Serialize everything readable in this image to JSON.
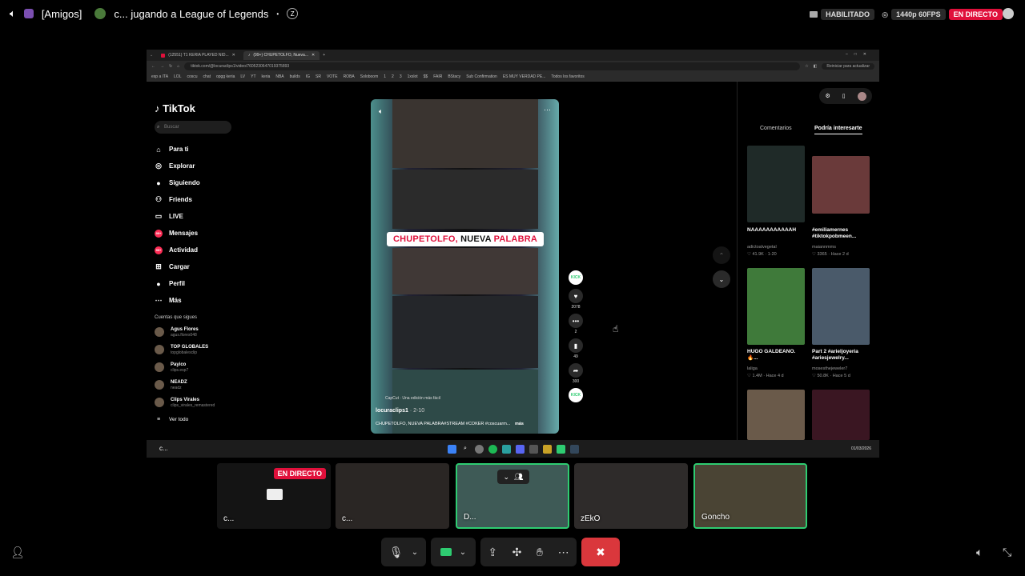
{
  "topbar": {
    "server": "[Amigos]",
    "activity": "c... jugando a League of Legends",
    "status_label": "HABILITADO",
    "quality": "1440p 60FPS",
    "live": "EN DIRECTO"
  },
  "browser": {
    "tabs": [
      {
        "label": "(12551) T1 KERIA PLAYED NID..."
      },
      {
        "label": "(99+) CHUPETOLFO, Nueva..."
      }
    ],
    "url": "tiktok.com/@locuraclips1/video/7605230647019375893",
    "update_button": "Reiniciar para actualizar",
    "bookmarks": [
      "esp a ITA",
      "LOL",
      "coscu",
      "chat",
      "opgg keria",
      "LV",
      "YT",
      "keria",
      "NBA",
      "builds",
      "IG",
      "SR",
      "VOTE",
      "ROBA",
      "Soloboom",
      "1",
      "2",
      "3",
      "1xslot",
      "$$",
      "FAIR",
      "BStacy",
      "Sub Confirmation",
      "ES MUY VERDAD PE...",
      "Todos los favoritos"
    ]
  },
  "tiktok": {
    "logo": "TikTok",
    "search_placeholder": "Buscar",
    "nav": [
      {
        "label": "Para ti",
        "icon": "home-icon"
      },
      {
        "label": "Explorar",
        "icon": "compass-icon"
      },
      {
        "label": "Siguiendo",
        "icon": "following-icon"
      },
      {
        "label": "Friends",
        "icon": "friends-icon"
      },
      {
        "label": "LIVE",
        "icon": "live-icon"
      },
      {
        "label": "Mensajes",
        "icon": "messages-icon"
      },
      {
        "label": "Actividad",
        "icon": "activity-icon"
      },
      {
        "label": "Cargar",
        "icon": "upload-icon"
      },
      {
        "label": "Perfil",
        "icon": "profile-icon"
      },
      {
        "label": "Más",
        "icon": "more-icon"
      }
    ],
    "badge": "99+",
    "following_title": "Cuentas que sigues",
    "accounts": [
      {
        "name": "Agus Flores",
        "handle": "agus.flores048"
      },
      {
        "name": "TOP GLOBALES",
        "handle": "topglobalesclip"
      },
      {
        "name": "Payico",
        "handle": "clips.esp7"
      },
      {
        "name": "NEADZ",
        "handle": "neadz"
      },
      {
        "name": "Clips Virales",
        "handle": "clips_virales_remastered"
      }
    ],
    "see_all": "Ver todo",
    "video": {
      "caption_red1": "CHUPETOLFO,",
      "caption_black": " NUEVA ",
      "caption_red2": "PALABRA",
      "capcut": "CapCut · Una edición más fácil",
      "author": "locuraclips1",
      "time": "· 2-10",
      "description": "CHUPETOLFO, NUEVA PALABRA#STREAM #COKER #coscuarm...",
      "more": "más"
    },
    "actions": {
      "likes": "2078",
      "comments": "2",
      "saves": "49",
      "shares": "300",
      "kick_label": "KICK"
    },
    "right_tabs": [
      "Comentarios",
      "Podría interesarte"
    ],
    "recommended": [
      {
        "title": "NAAAAAAAAAAAH",
        "author": "adictoalvegetal",
        "views": "41.9K",
        "age": "1-20"
      },
      {
        "title": "#emiliamernes #tiktokpobmeen...",
        "author": "maiannmms",
        "views": "3365",
        "age": "Hace 2 d"
      },
      {
        "title": "HUGO GALDEANO. 🔥...",
        "author": "laliga",
        "views": "1.4M",
        "age": "Hace 4 d"
      },
      {
        "title": "Part 2 #arieljoyeria #ariesjewelry...",
        "author": "mosesthejeweler7",
        "views": "50.8K",
        "age": "Hace 5 d"
      }
    ]
  },
  "taskbar": {
    "clock": "01/03/2026",
    "chat_label": "c..."
  },
  "tiles": [
    {
      "label": "c...",
      "badge": "EN DIRECTO"
    },
    {
      "label": "c..."
    },
    {
      "label": "D..."
    },
    {
      "label": "zEkO"
    },
    {
      "label": "Goncho"
    }
  ],
  "colors": {
    "live_red": "#e0103b",
    "tiktok_pink": "#fe2c55",
    "green": "#2ecc71"
  }
}
